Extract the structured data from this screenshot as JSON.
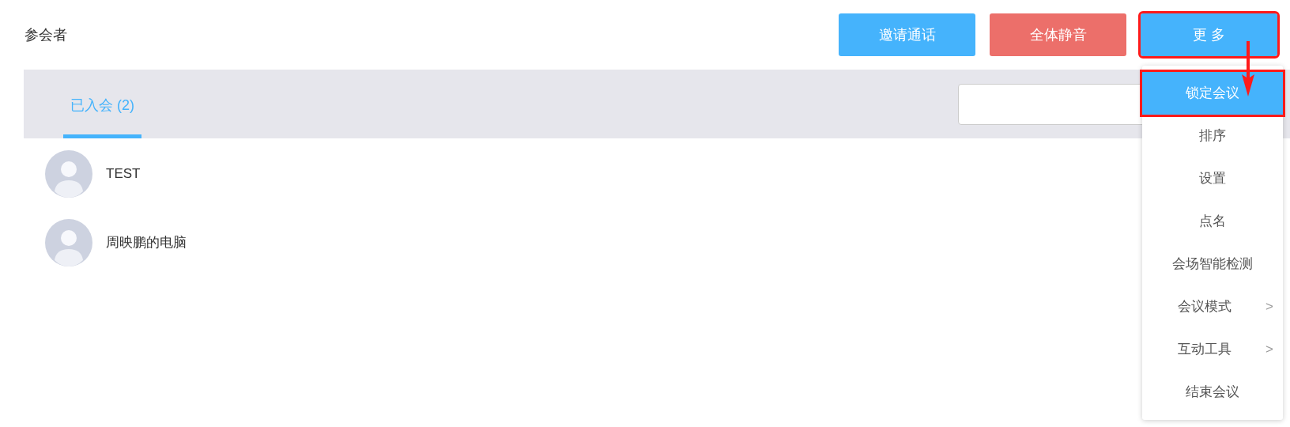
{
  "title": "参会者",
  "buttons": [
    {
      "label": "邀请通话",
      "kind": "primary",
      "highlighted": false
    },
    {
      "label": "全体静音",
      "kind": "danger",
      "highlighted": false
    },
    {
      "label": "更 多",
      "kind": "primary",
      "highlighted": true
    }
  ],
  "tabs": [
    {
      "label": "已入会 (2)",
      "selected": true
    }
  ],
  "participants": [
    {
      "name": "TEST"
    },
    {
      "name": "周映鹏的电脑"
    }
  ],
  "menu": [
    {
      "label": "锁定会议",
      "selected": true,
      "highlighted": true,
      "submenu": false
    },
    {
      "label": "排序",
      "selected": false,
      "highlighted": false,
      "submenu": false
    },
    {
      "label": "设置",
      "selected": false,
      "highlighted": false,
      "submenu": false
    },
    {
      "label": "点名",
      "selected": false,
      "highlighted": false,
      "submenu": false
    },
    {
      "label": "会场智能检测",
      "selected": false,
      "highlighted": false,
      "submenu": false
    },
    {
      "label": "会议模式",
      "selected": false,
      "highlighted": false,
      "submenu": true,
      "arrow": ">"
    },
    {
      "label": "互动工具",
      "selected": false,
      "highlighted": false,
      "submenu": true,
      "arrow": ">"
    },
    {
      "label": "结束会议",
      "selected": false,
      "highlighted": false,
      "submenu": false
    }
  ]
}
